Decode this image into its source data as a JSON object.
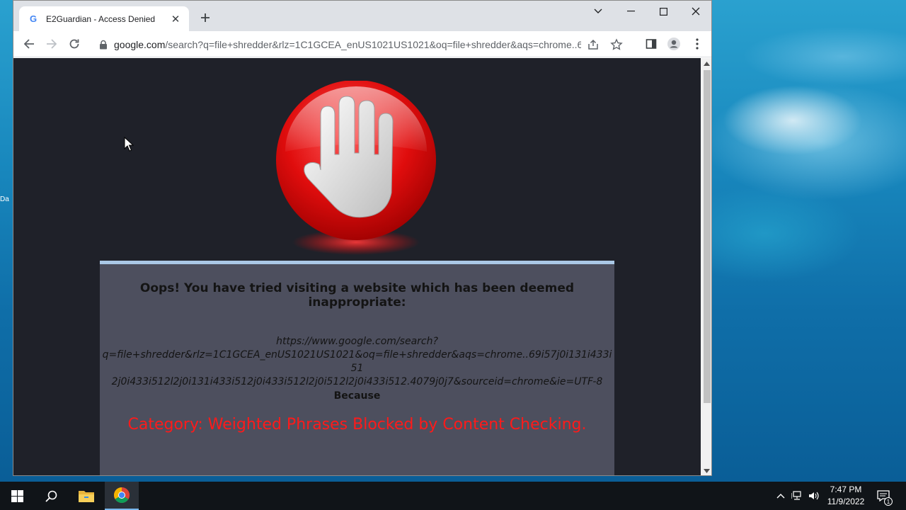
{
  "browser": {
    "tab": {
      "favicon": "G",
      "title": "E2Guardian - Access Denied",
      "close_icon": "close-icon"
    },
    "new_tab_icon": "plus-icon",
    "address": {
      "host": "google.com",
      "path": "/search?q=file+shredder&rlz=1C1GCEA_enUS1021US1021&oq=file+shredder&aqs=chrome..6..."
    }
  },
  "page": {
    "heading": "Oops! You have tried visiting a website which has been deemed inappropriate:",
    "blocked_url_line1": "https://www.google.com/search?",
    "blocked_url_line2": "q=file+shredder&rlz=1C1GCEA_enUS1021US1021&oq=file+shredder&aqs=chrome..69i57j0i131i433i51",
    "blocked_url_line3": "2j0i433i512l2j0i131i433i512j0i433i512l2j0i512l2j0i433i512.4079j0j7&sourceid=chrome&ie=UTF-8",
    "because": "Because",
    "reason": "Category: Weighted Phrases Blocked by Content Checking.",
    "accent_color": "#ff1a1a"
  },
  "desktop": {
    "icon_label_fragment": "Da"
  },
  "taskbar": {
    "time": "7:47 PM",
    "date": "11/9/2022",
    "notification_count": "1"
  }
}
